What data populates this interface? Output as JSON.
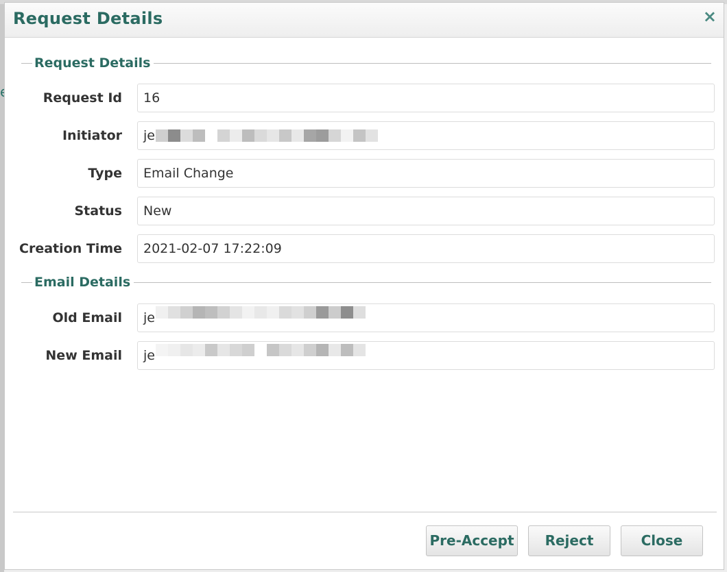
{
  "dialog": {
    "title": "Request Details",
    "close_glyph": "×"
  },
  "backdrop": {
    "glyph": "e"
  },
  "request_details": {
    "legend": "Request Details",
    "fields": [
      {
        "label": "Request Id",
        "value": "16"
      },
      {
        "label": "Initiator",
        "value": "je"
      },
      {
        "label": "Type",
        "value": "Email Change"
      },
      {
        "label": "Status",
        "value": "New"
      },
      {
        "label": "Creation Time",
        "value": "2021-02-07 17:22:09"
      }
    ]
  },
  "email_details": {
    "legend": "Email Details",
    "fields": [
      {
        "label": "Old Email",
        "value": "je"
      },
      {
        "label": "New Email",
        "value": "je"
      }
    ]
  },
  "buttons": {
    "pre_accept": "Pre-Accept",
    "reject": "Reject",
    "close": "Close"
  },
  "colors": {
    "accent": "#2b6b62",
    "label": "#333333",
    "border": "#dcdcdc"
  },
  "icons": {
    "close": "close-icon"
  }
}
